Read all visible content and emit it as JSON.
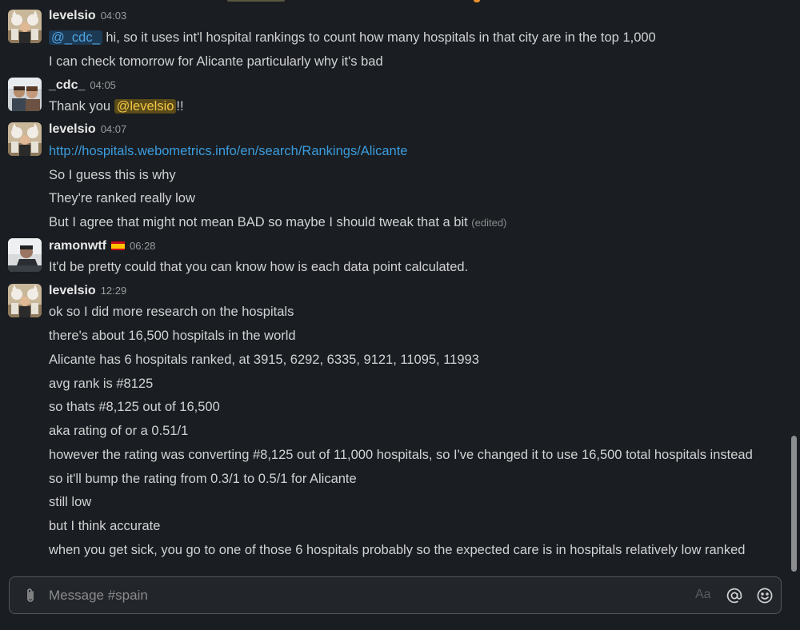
{
  "channel": {
    "name": "spain",
    "composer_placeholder": "Message #spain",
    "format_label": "Aa"
  },
  "messages": [
    {
      "author": "levelsio",
      "time": "04:03",
      "avatar": "levelsio-avatar",
      "lines": [
        {
          "mention": "@_cdc_",
          "text": " hi, so it uses int'l hospital rankings to count how many hospitals in that city are in the top 1,000"
        },
        {
          "text": "I can check tomorrow for Alicante particularly why it's bad"
        }
      ]
    },
    {
      "author": "_cdc_",
      "time": "04:05",
      "avatar": "cdc-avatar",
      "lines": [
        {
          "before": "Thank you ",
          "mention": "@levelsio",
          "after": "!!"
        }
      ]
    },
    {
      "author": "levelsio",
      "time": "04:07",
      "avatar": "levelsio-avatar",
      "lines": [
        {
          "link": "http://hospitals.webometrics.info/en/search/Rankings/Alicante"
        },
        {
          "text": "So I guess this is why"
        },
        {
          "text": "They're ranked really low"
        },
        {
          "text": "But I agree that might not mean BAD so maybe I should tweak that a bit ",
          "edited": "(edited)"
        }
      ]
    },
    {
      "author": "ramonwtf",
      "time": "06:28",
      "flag": "spain-flag-icon",
      "avatar": "ramonwtf-avatar",
      "lines": [
        {
          "text": "It'd be pretty could that you can know how is each data point calculated."
        }
      ]
    },
    {
      "author": "levelsio",
      "time": "12:29",
      "avatar": "levelsio-avatar",
      "lines": [
        {
          "text": "ok so I did more research on the hospitals"
        },
        {
          "text": "there's about 16,500 hospitals in the world"
        },
        {
          "text": "Alicante has 6 hospitals ranked, at 3915, 6292, 6335, 9121, 11095, 11993"
        },
        {
          "text": "avg rank is #8125"
        },
        {
          "text": "so thats #8,125 out of 16,500"
        },
        {
          "text": "aka rating of or a 0.51/1"
        },
        {
          "text": "however the rating was converting #8,125 out of 11,000 hospitals, so I've changed it to use 16,500 total hospitals instead"
        },
        {
          "text": "so it'll bump the rating from 0.3/1 to 0.5/1 for Alicante"
        },
        {
          "text": "still low"
        },
        {
          "text": "but I think accurate"
        },
        {
          "text": "when you get sick, you go to one of those 6 hospitals probably so the expected care is in hospitals relatively low ranked"
        }
      ]
    }
  ],
  "colors": {
    "background": "#1a1d21",
    "mention_bg": "#1d3a55",
    "mention_fg": "#4fa4e0",
    "self_mention_bg": "#5b4b19",
    "self_mention_fg": "#f2c744",
    "link": "#3b9cde"
  },
  "icons": [
    "paperclip-icon",
    "format-icon",
    "at-icon",
    "emoji-icon"
  ]
}
